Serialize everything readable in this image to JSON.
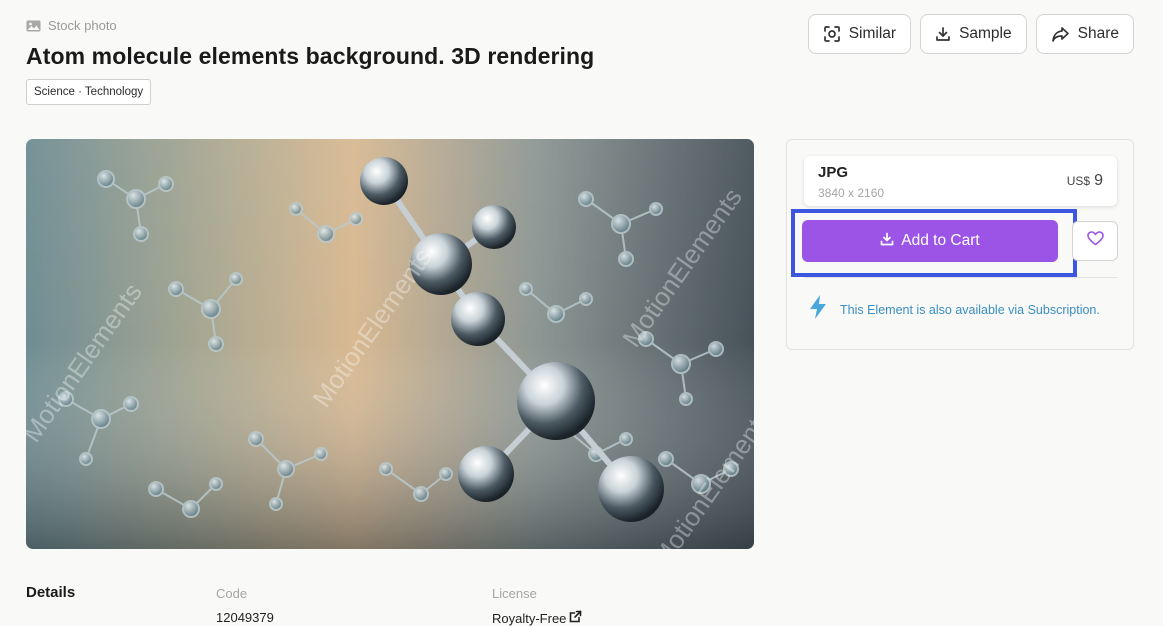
{
  "header": {
    "breadcrumb": "Stock photo",
    "title": "Atom molecule elements background. 3D rendering",
    "tag": "Science · Technology"
  },
  "actions": [
    {
      "label": "Similar",
      "icon": "similar-icon"
    },
    {
      "label": "Sample",
      "icon": "download-icon"
    },
    {
      "label": "Share",
      "icon": "share-icon"
    }
  ],
  "preview": {
    "watermark": "MotionElements",
    "description_icon": "image-icon"
  },
  "buybox": {
    "format": "JPG",
    "resolution": "3840 x 2160",
    "currency": "US$",
    "price": "9",
    "add_to_cart": "Add to Cart",
    "subscription_note": "This Element is also available via Subscription.",
    "accent_color": "#9b54e6",
    "link_color": "#3a8ec2",
    "highlight_color": "#3d56e0"
  },
  "details": {
    "heading": "Details",
    "code_label": "Code",
    "code_value": "12049379",
    "license_label": "License",
    "license_value": "Royalty-Free"
  }
}
